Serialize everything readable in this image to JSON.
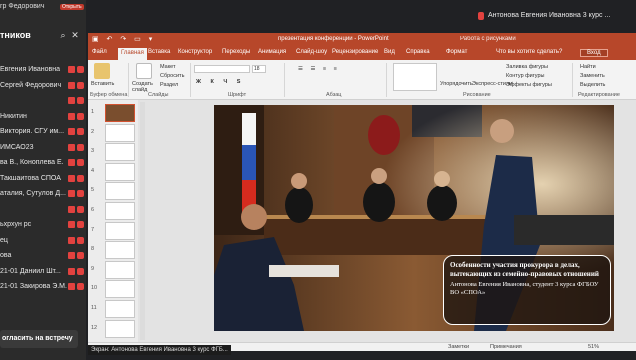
{
  "call": {
    "caller_name": "гр Федорович",
    "rec_badge": "Открыть",
    "panel_title": "тников",
    "participants": [
      {
        "name": "Евгения Ивановна"
      },
      {
        "name": "Сергей Федорович"
      },
      {
        "name": ""
      },
      {
        "name": "Никитин"
      },
      {
        "name": "Виктория. СГУ им..."
      },
      {
        "name": "ИМСАО23"
      },
      {
        "name": "ва В., Коноплева Е."
      },
      {
        "name": "Такшаитова СПОА"
      },
      {
        "name": "аталия, Сутулов Д..."
      },
      {
        "name": ""
      },
      {
        "name": "ьхрхун рс"
      },
      {
        "name": "ец"
      },
      {
        "name": "ова"
      },
      {
        "name": "21-01 Даниил Шт..."
      },
      {
        "name": "21-01 Закирова Э.М."
      }
    ],
    "invite_label": "огласить на встречу",
    "top_right_name": "Антонова Евгения Ивановна 3 курс ..."
  },
  "ppt": {
    "title": "презентация конференции - PowerPoint",
    "user_tag": "Работа с рисунками",
    "tabs": [
      "Файл",
      "Главная",
      "Вставка",
      "Конструктор",
      "Переходы",
      "Анимация",
      "Слайд-шоу",
      "Рецензирование",
      "Вид",
      "Справка",
      "Формат"
    ],
    "active_tab": "Главная",
    "tell_me": "Что вы хотите сделать?",
    "sign_in": "Вход",
    "ribbon": {
      "paste": "Вставить",
      "create_slide": "Создать слайд",
      "clipboard": "Буфер обмена",
      "slides": "Слайды",
      "font": "Шрифт",
      "paragraph": "Абзац",
      "drawing": "Рисование",
      "editing": "Редактирование",
      "layout": "Макет",
      "reset": "Сбросить",
      "section": "Раздел",
      "font_size": "18",
      "arrange": "Упорядочить",
      "quick_styles": "Экспресс-стили",
      "fill": "Заливка фигуры",
      "outline": "Контур фигуры",
      "effects": "Эффекты фигуры",
      "find": "Найти",
      "replace": "Заменить",
      "select": "Выделить"
    },
    "thumbnails": [
      "1",
      "2",
      "3",
      "4",
      "5",
      "6",
      "7",
      "8",
      "9",
      "10",
      "11",
      "12"
    ],
    "selected_thumb": 0,
    "slide": {
      "caption_title": "Особенности участия прокурора в делах, вытекающих из семейно-правовых отношений",
      "caption_sub": "Антонова Евгения Ивановна, студент 3 курса ФГБОУ ВО «СПОА»"
    },
    "status": {
      "notes": "Заметки",
      "comments": "Примечания",
      "zoom": "51%"
    }
  },
  "screen_share_label": "Экран: Антонова Евгения Ивановна 3 курс ФГБ..."
}
